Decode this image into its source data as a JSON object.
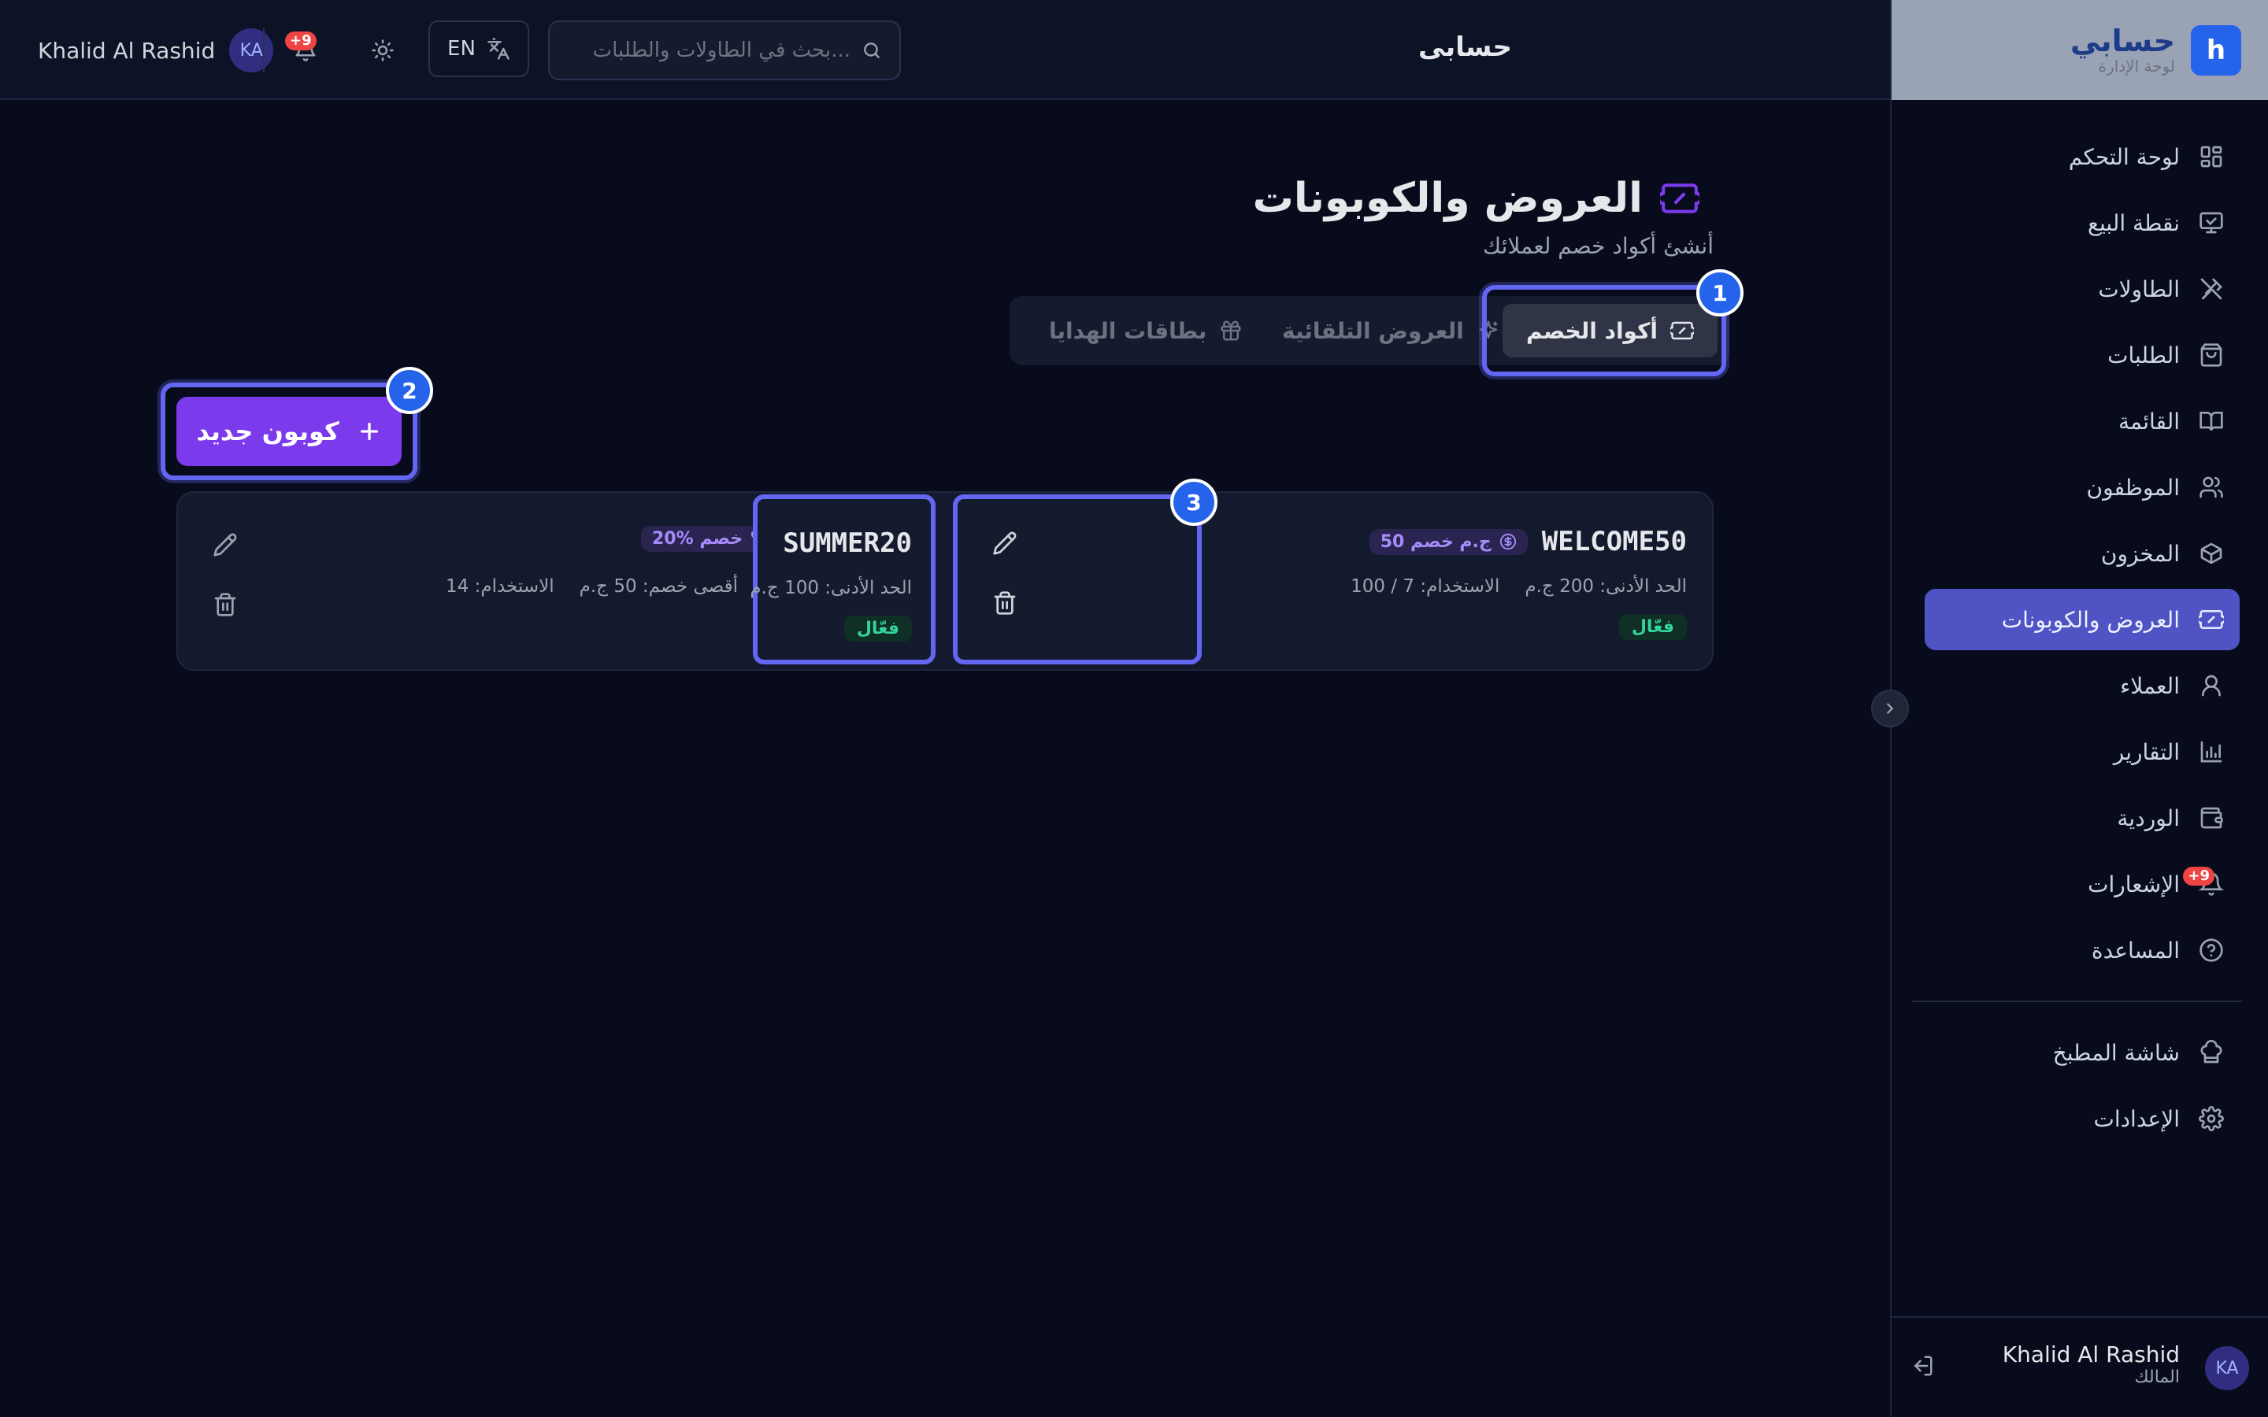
{
  "topbar": {
    "user_name": "Khalid Al Rashid",
    "user_initials": "KA",
    "notif_badge": "+9",
    "lang_label": "EN",
    "search_placeholder": "بحث في الطاولات والطلبات...",
    "title": "حسابى"
  },
  "brand": {
    "title": "حسابي",
    "subtitle": "لوحة الإدارة",
    "logo_letter": "h"
  },
  "sidebar": {
    "items": [
      {
        "label": "لوحة التحكم",
        "icon": "dashboard-icon"
      },
      {
        "label": "نقطة البيع",
        "icon": "monitor-icon"
      },
      {
        "label": "الطاولات",
        "icon": "utensils-icon"
      },
      {
        "label": "الطلبات",
        "icon": "bag-icon"
      },
      {
        "label": "القائمة",
        "icon": "book-icon"
      },
      {
        "label": "الموظفون",
        "icon": "users-icon"
      },
      {
        "label": "المخزون",
        "icon": "box-icon"
      },
      {
        "label": "العروض والكوبونات",
        "icon": "ticket-icon",
        "active": true
      },
      {
        "label": "العملاء",
        "icon": "user-icon"
      },
      {
        "label": "التقارير",
        "icon": "chart-icon"
      },
      {
        "label": "الوردية",
        "icon": "wallet-icon"
      },
      {
        "label": "الإشعارات",
        "icon": "bell-icon",
        "badge": "+9"
      },
      {
        "label": "المساعدة",
        "icon": "help-icon"
      }
    ],
    "bottom_items": [
      {
        "label": "شاشة المطبخ",
        "icon": "chef-icon"
      },
      {
        "label": "الإعدادات",
        "icon": "gear-icon"
      }
    ],
    "user": {
      "name": "Khalid Al Rashid",
      "role": "المالك",
      "initials": "KA"
    }
  },
  "page": {
    "title": "العروض والكوبونات",
    "subtitle": "أنشئ أكواد خصم لعملائك",
    "tabs": [
      {
        "label": "أكواد الخصم",
        "active": true
      },
      {
        "label": "العروض التلقائية"
      },
      {
        "label": "بطاقات الهدايا"
      }
    ],
    "new_button": "كوبون جديد"
  },
  "coupons": [
    {
      "code": "WELCOME50",
      "discount": "50 ج.م خصم",
      "min_order": "الحد الأدنى: 200 ج.م",
      "usage": "الاستخدام: 7 / 100",
      "status": "فعّال"
    },
    {
      "code": "SUMMER20",
      "discount": "20% خصم",
      "min_order": "الحد الأدنى: 100 ج.م",
      "max_discount": "أقصى خصم: 50 ج.م",
      "usage": "الاستخدام: 14",
      "status": "فعّال"
    }
  ],
  "markers": [
    "1",
    "2",
    "3"
  ],
  "colors": {
    "accent": "#6366f1",
    "primary_button": "#7c3aed",
    "background": "#070b1b",
    "active_status": "#34d399"
  }
}
